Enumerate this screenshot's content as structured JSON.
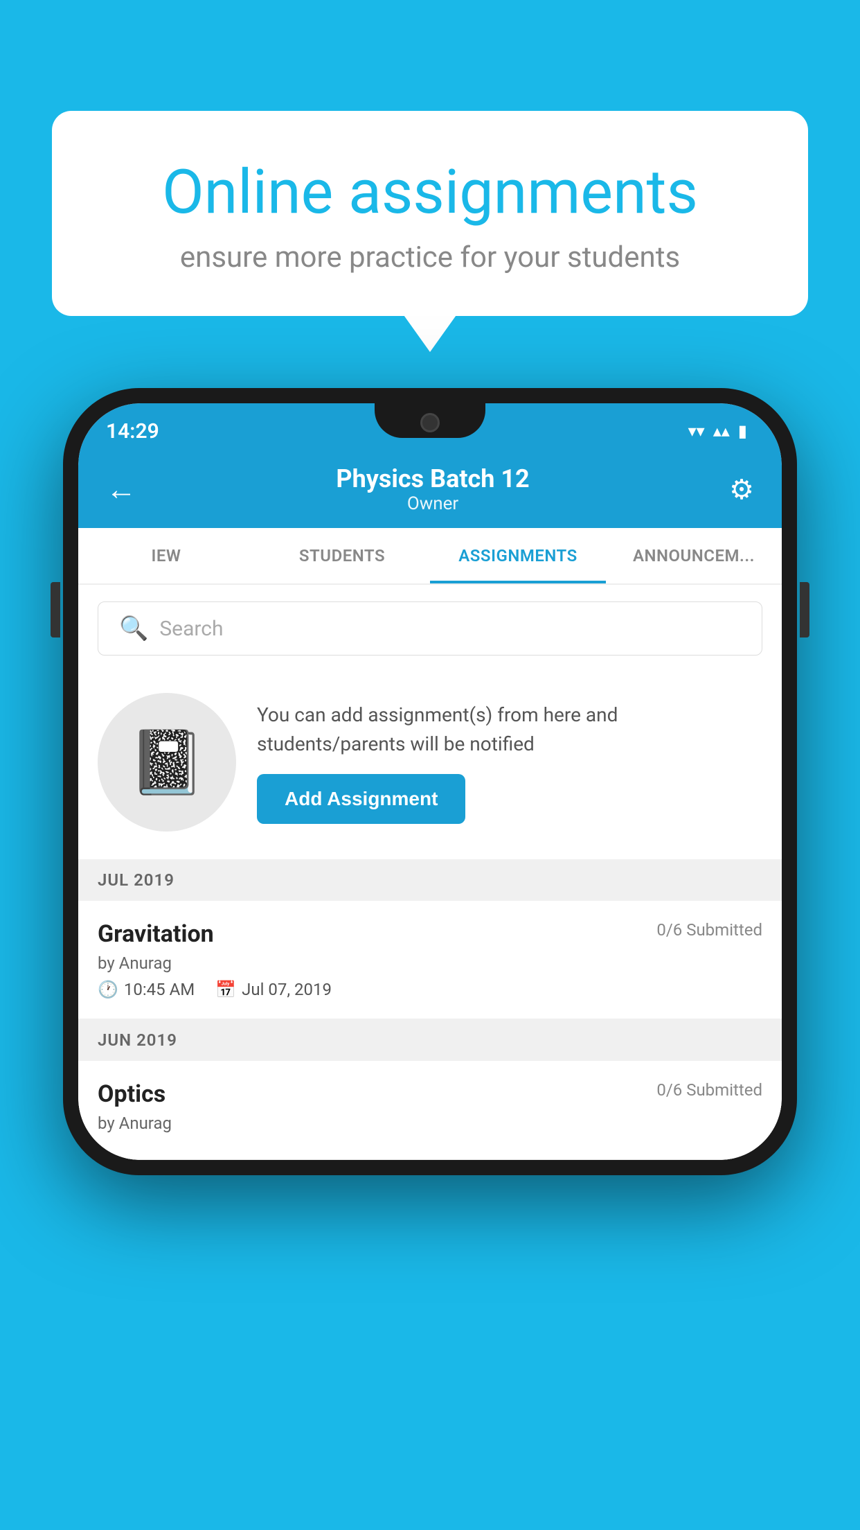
{
  "background": {
    "color": "#1ab8e8"
  },
  "speech_bubble": {
    "title": "Online assignments",
    "subtitle": "ensure more practice for your students"
  },
  "status_bar": {
    "time": "14:29",
    "wifi_icon": "▼",
    "signal_icon": "▲",
    "battery_icon": "▮"
  },
  "app_bar": {
    "back_icon": "←",
    "title": "Physics Batch 12",
    "subtitle": "Owner",
    "gear_icon": "⚙"
  },
  "tabs": [
    {
      "label": "IEW",
      "active": false
    },
    {
      "label": "STUDENTS",
      "active": false
    },
    {
      "label": "ASSIGNMENTS",
      "active": true
    },
    {
      "label": "ANNOUNCEMENTS",
      "active": false
    }
  ],
  "search": {
    "placeholder": "Search",
    "icon": "🔍"
  },
  "promo": {
    "description": "You can add assignment(s) from here and students/parents will be notified",
    "add_button_label": "Add Assignment"
  },
  "sections": [
    {
      "header": "JUL 2019",
      "assignments": [
        {
          "name": "Gravitation",
          "submitted": "0/6 Submitted",
          "author": "by Anurag",
          "time": "10:45 AM",
          "date": "Jul 07, 2019"
        }
      ]
    },
    {
      "header": "JUN 2019",
      "assignments": [
        {
          "name": "Optics",
          "submitted": "0/6 Submitted",
          "author": "by Anurag",
          "time": "",
          "date": ""
        }
      ]
    }
  ]
}
